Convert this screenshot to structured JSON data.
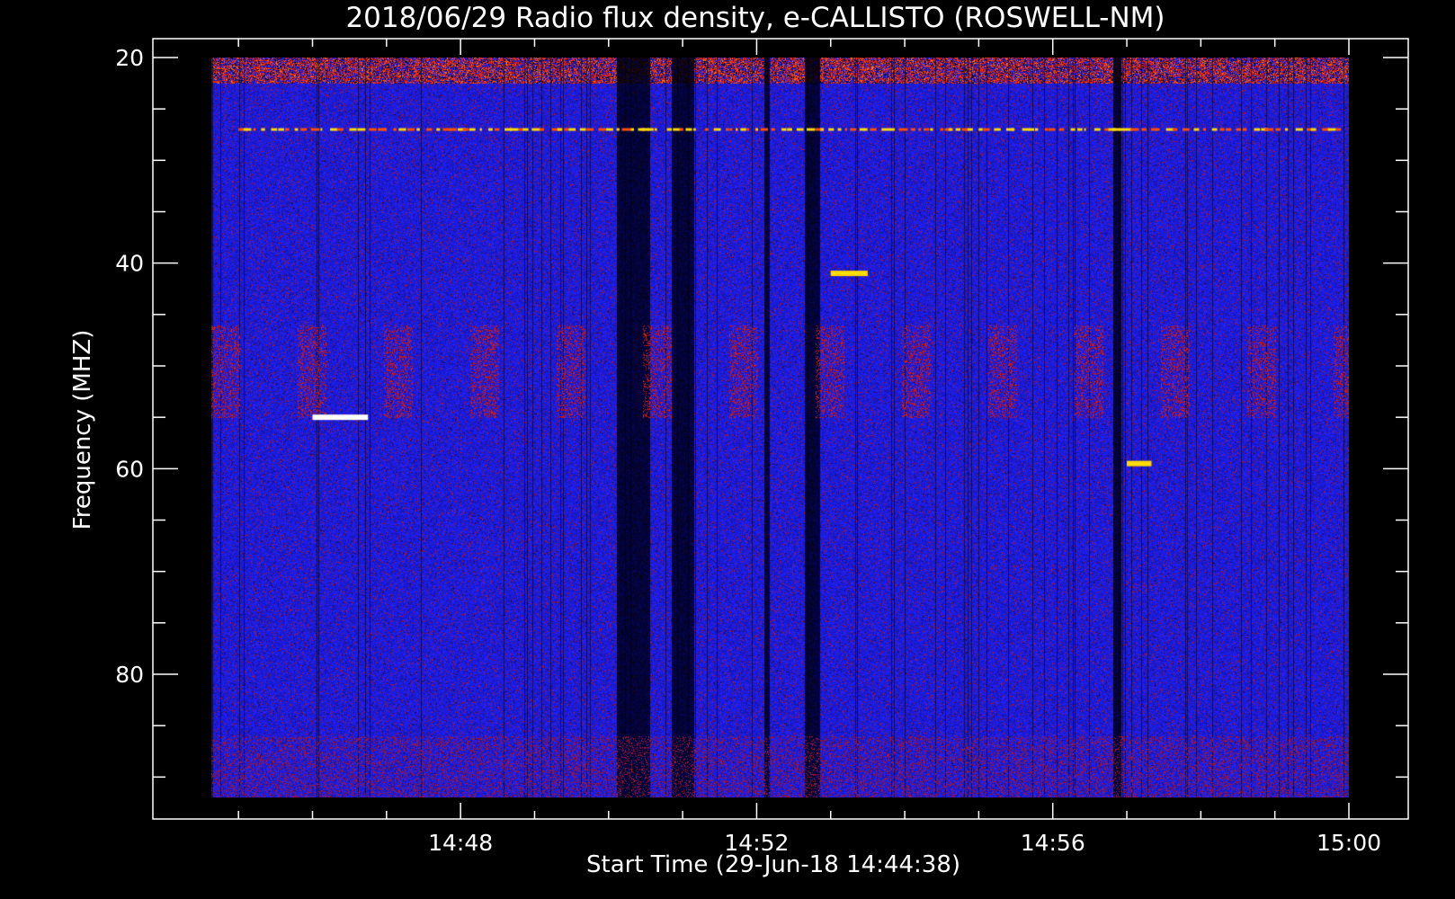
{
  "chart_data": {
    "type": "heatmap",
    "title": "2018/06/29  Radio flux density, e-CALLISTO (ROSWELL-NM)",
    "xlabel": "Start Time (29-Jun-18 14:44:38)",
    "ylabel": "Frequency (MHZ)",
    "x_range": [
      "14:44:38",
      "15:00:00"
    ],
    "x_ticks": [
      "14:48",
      "14:52",
      "14:56",
      "15:00"
    ],
    "x_minor_tick_step_min": 1,
    "ylim": [
      18,
      93
    ],
    "y_data_range": [
      20,
      92
    ],
    "y_ticks": [
      20,
      40,
      60,
      80
    ],
    "y_minor_tick_step": 5,
    "y_inverted": true,
    "colormap": [
      "#000000",
      "#1a1ab4",
      "#3a3af0",
      "#8c1e5a",
      "#c8281e",
      "#ff3c00",
      "#ffdc00",
      "#ffffff"
    ],
    "background_color": "#2a2aec",
    "dark_lanes": [
      {
        "time": "14:50:20",
        "width_min": 0.45
      },
      {
        "time": "14:51:00",
        "width_min": 0.3
      },
      {
        "time": "14:52:08",
        "width_min": 0.08
      },
      {
        "time": "14:52:45",
        "width_min": 0.2
      },
      {
        "time": "14:56:52",
        "width_min": 0.1
      }
    ],
    "bright_features": [
      {
        "freq_mhz": 27,
        "from": "14:45:00",
        "to": "14:59:50",
        "level": "yellow",
        "note": "interference line"
      },
      {
        "freq_mhz": 41,
        "from": "14:53:00",
        "to": "14:53:30",
        "level": "yellow"
      },
      {
        "freq_mhz": 55,
        "from": "14:46:00",
        "to": "14:46:45",
        "level": "white"
      },
      {
        "freq_mhz": 59.5,
        "from": "14:57:00",
        "to": "14:57:20",
        "level": "yellow"
      }
    ]
  }
}
